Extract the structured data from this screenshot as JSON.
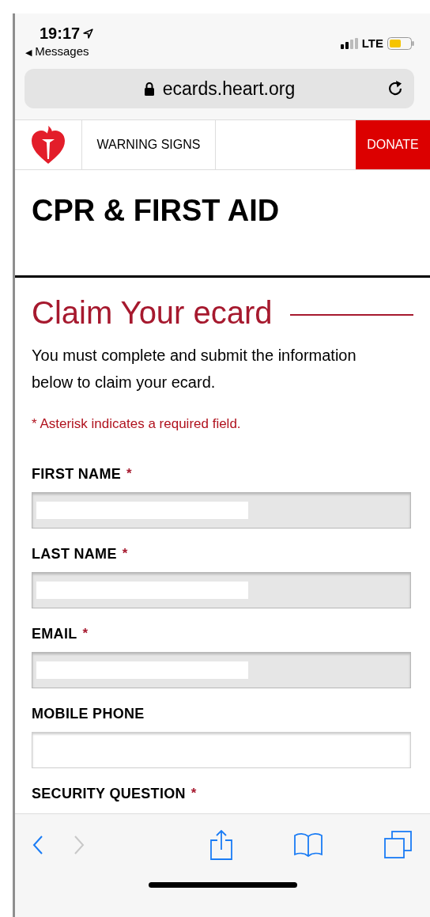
{
  "status_bar": {
    "time": "19:17",
    "back_arrow": "◀",
    "back_app": "Messages",
    "network": "LTE"
  },
  "address_bar": {
    "url": "ecards.heart.org"
  },
  "nav": {
    "items": [
      {
        "label": "WARNING SIGNS",
        "kind": "link"
      },
      {
        "label": "DONATE",
        "kind": "donate"
      }
    ]
  },
  "page_title": "CPR & FIRST AID",
  "heading": "Claim Your ecard",
  "intro": "You must complete and submit the information below to claim your ecard.",
  "required_note": "* Asterisk indicates a required field.",
  "required_mark": "*",
  "fields": [
    {
      "label": "FIRST NAME",
      "required": true,
      "filled": true
    },
    {
      "label": "LAST NAME",
      "required": true,
      "filled": true
    },
    {
      "label": "EMAIL",
      "required": true,
      "filled": true
    },
    {
      "label": "MOBILE PHONE",
      "required": false,
      "filled": false
    }
  ],
  "next_label": {
    "label": "SECURITY QUESTION",
    "required": true
  },
  "toolbar": {
    "back_enabled": true,
    "forward_enabled": false
  }
}
